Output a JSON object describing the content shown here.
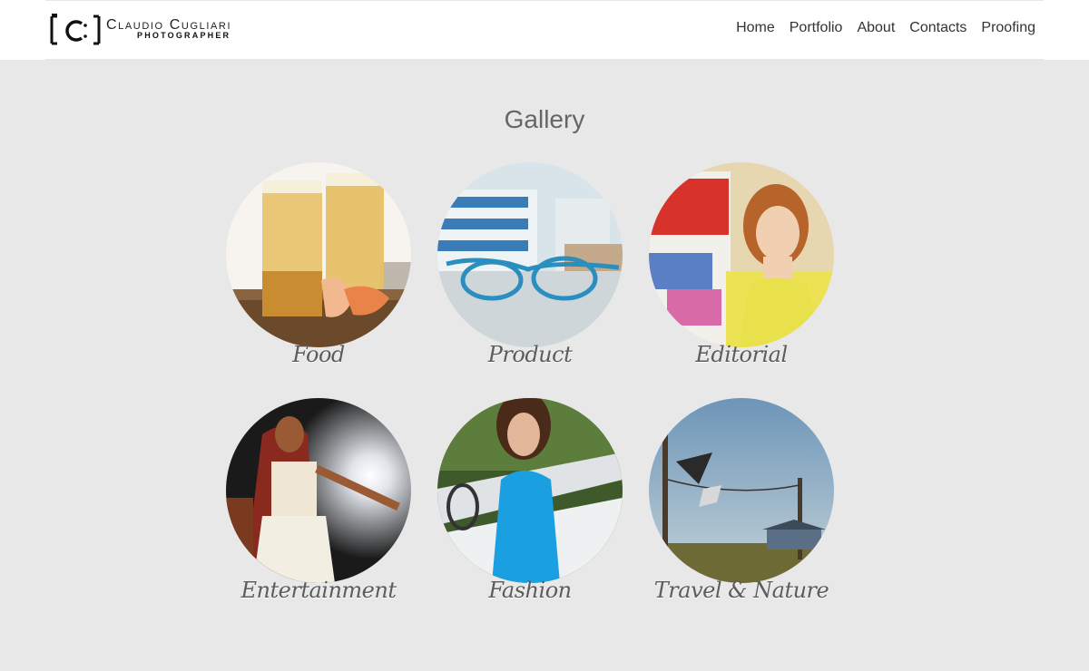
{
  "header": {
    "logo": {
      "mark": "[C]",
      "name": "Claudio Cugliari",
      "subtitle": "PHOTOGRAPHER"
    },
    "nav": [
      "Home",
      "Portfolio",
      "About",
      "Contacts",
      "Proofing"
    ]
  },
  "main": {
    "title": "Gallery",
    "items": [
      {
        "label": "Food"
      },
      {
        "label": "Product"
      },
      {
        "label": "Editorial"
      },
      {
        "label": "Entertainment"
      },
      {
        "label": "Fashion"
      },
      {
        "label": "Travel & Nature"
      }
    ]
  },
  "colors": {
    "background": "#e8e8e8",
    "header": "#ffffff",
    "text": "#333333",
    "title": "#666666"
  }
}
